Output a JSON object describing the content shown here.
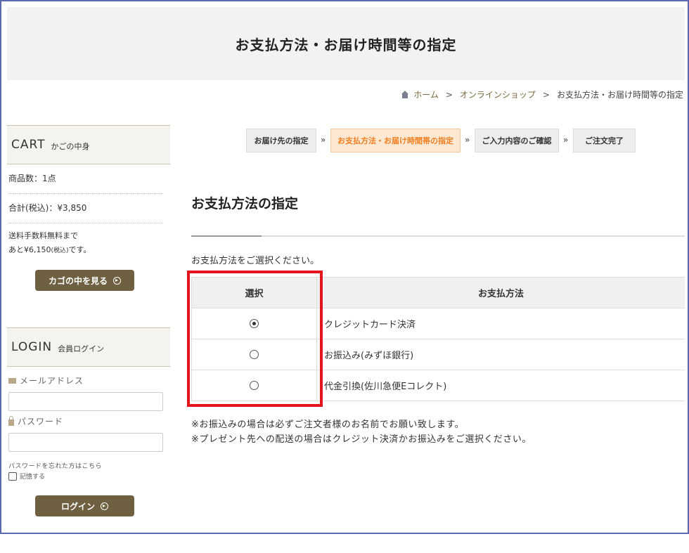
{
  "page": {
    "title": "お支払方法・お届け時間等の指定"
  },
  "breadcrumb": {
    "home": "ホーム",
    "sep": ">",
    "shop": "オンラインショップ",
    "current": "お支払方法・お届け時間等の指定"
  },
  "cart": {
    "heading": "CART",
    "subheading": "かごの中身",
    "count": "商品数：1点",
    "total": "合計(税込)：¥3,850",
    "free_shipping_line1": "送料手数料無料まで",
    "free_shipping_line2_prefix": "あと¥6,150",
    "free_shipping_line2_tax": "(税込)",
    "free_shipping_line2_suffix": "です。",
    "view_button": "カゴの中を見る"
  },
  "login": {
    "heading": "LOGIN",
    "subheading": "会員ログイン",
    "email_label": "メールアドレス",
    "password_label": "パスワード",
    "forgot": "パスワードを忘れた方はこちら",
    "remember": "記憶する",
    "button": "ログイン"
  },
  "steps": {
    "items": [
      {
        "label": "お届け先の指定",
        "active": false
      },
      {
        "label": "お支払方法・お届け時間帯の指定",
        "active": true
      },
      {
        "label": "ご入力内容のご確認",
        "active": false
      },
      {
        "label": "ご注文完了",
        "active": false
      }
    ],
    "separator": "»"
  },
  "main": {
    "section_title": "お支払方法の指定",
    "instruction": "お支払方法をご選択ください。",
    "table": {
      "headers": [
        "選択",
        "お支払方法"
      ],
      "rows": [
        {
          "method": "クレジットカード決済",
          "selected": true
        },
        {
          "method": "お振込み(みずほ銀行)",
          "selected": false
        },
        {
          "method": "代金引換(佐川急便Eコレクト)",
          "selected": false
        }
      ]
    },
    "notes": [
      "※お振込みの場合は必ずご注文者様のお名前でお願い致します。",
      "※プレゼント先への配送の場合はクレジット決済かお振込みをご選択ください。"
    ]
  },
  "colors": {
    "accent_brown": "#6e6040",
    "active_step_bg": "#fde8d4",
    "active_step_text": "#ee7f1f",
    "highlight_red": "#e5131b",
    "frame_border": "#5b6ab0"
  }
}
